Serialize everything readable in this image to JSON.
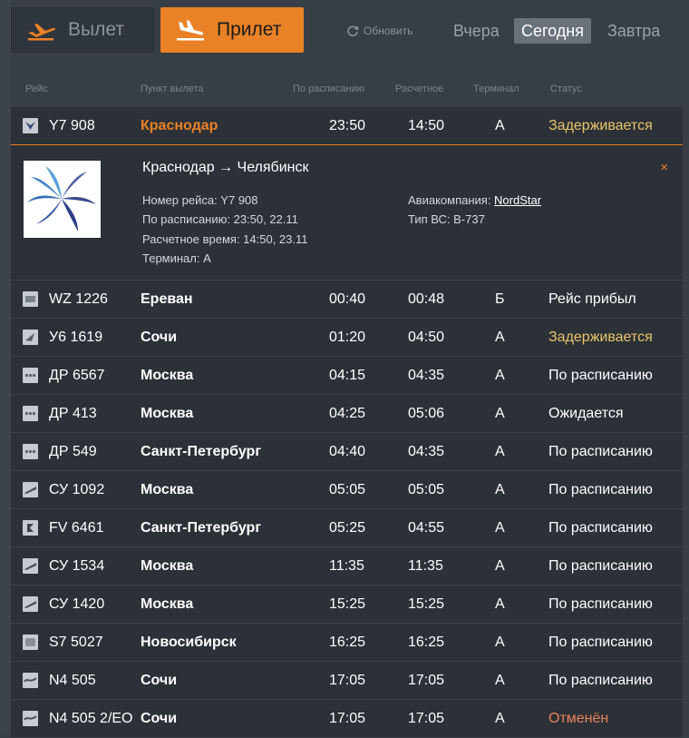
{
  "header": {
    "departures_label": "Вылет",
    "arrivals_label": "Прилет",
    "refresh_label": "Обновить",
    "days": {
      "yesterday": "Вчера",
      "today": "Сегодня",
      "tomorrow": "Завтра"
    }
  },
  "columns": {
    "flight": "Рейс",
    "origin": "Пункт вылета",
    "scheduled": "По расписанию",
    "estimated": "Расчетное",
    "terminal": "Терминал",
    "status": "Статус"
  },
  "colors": {
    "accent": "#e98126",
    "delayed": "#e8c46a",
    "cancelled": "#e8825a"
  },
  "selected_flight": {
    "flight": "Y7 908",
    "city": "Краснодар",
    "scheduled": "23:50",
    "estimated": "14:50",
    "terminal": "А",
    "status": "Задерживается",
    "route": "Краснодар → Челябинск",
    "flight_number_line": "Номер рейса: Y7 908",
    "scheduled_line": "По расписанию: 23:50, 22.11",
    "estimated_line": "Расчетное время: 14:50, 23.11",
    "terminal_line": "Терминал: А",
    "airline_label": "Авиакомпания: ",
    "airline_name": "NordStar",
    "aircraft_line": "Тип ВС: B-737",
    "close_icon": "×"
  },
  "flights": [
    {
      "flight": "WZ 1226",
      "city": "Ереван",
      "scheduled": "00:40",
      "estimated": "00:48",
      "terminal": "Б",
      "status": "Рейс прибыл",
      "status_type": "normal"
    },
    {
      "flight": "У6 1619",
      "city": "Сочи",
      "scheduled": "01:20",
      "estimated": "04:50",
      "terminal": "А",
      "status": "Задерживается",
      "status_type": "delayed"
    },
    {
      "flight": "ДР 6567",
      "city": "Москва",
      "scheduled": "04:15",
      "estimated": "04:35",
      "terminal": "А",
      "status": "По расписанию",
      "status_type": "normal"
    },
    {
      "flight": "ДР 413",
      "city": "Москва",
      "scheduled": "04:25",
      "estimated": "05:06",
      "terminal": "А",
      "status": "Ожидается",
      "status_type": "normal"
    },
    {
      "flight": "ДР 549",
      "city": "Санкт-Петербург",
      "scheduled": "04:40",
      "estimated": "04:35",
      "terminal": "А",
      "status": "По расписанию",
      "status_type": "normal"
    },
    {
      "flight": "СУ 1092",
      "city": "Москва",
      "scheduled": "05:05",
      "estimated": "05:05",
      "terminal": "А",
      "status": "По расписанию",
      "status_type": "normal"
    },
    {
      "flight": "FV 6461",
      "city": "Санкт-Петербург",
      "scheduled": "05:25",
      "estimated": "04:55",
      "terminal": "А",
      "status": "По расписанию",
      "status_type": "normal"
    },
    {
      "flight": "СУ 1534",
      "city": "Москва",
      "scheduled": "11:35",
      "estimated": "11:35",
      "terminal": "А",
      "status": "По расписанию",
      "status_type": "normal"
    },
    {
      "flight": "СУ 1420",
      "city": "Москва",
      "scheduled": "15:25",
      "estimated": "15:25",
      "terminal": "А",
      "status": "По расписанию",
      "status_type": "normal"
    },
    {
      "flight": "S7 5027",
      "city": "Новосибирск",
      "scheduled": "16:25",
      "estimated": "16:25",
      "terminal": "А",
      "status": "По расписанию",
      "status_type": "normal"
    },
    {
      "flight": "N4 505",
      "city": "Сочи",
      "scheduled": "17:05",
      "estimated": "17:05",
      "terminal": "А",
      "status": "По расписанию",
      "status_type": "normal"
    },
    {
      "flight": "N4 505 2/EO",
      "city": "Сочи",
      "scheduled": "17:05",
      "estimated": "17:05",
      "terminal": "А",
      "status": "Отменён",
      "status_type": "cancelled"
    }
  ]
}
